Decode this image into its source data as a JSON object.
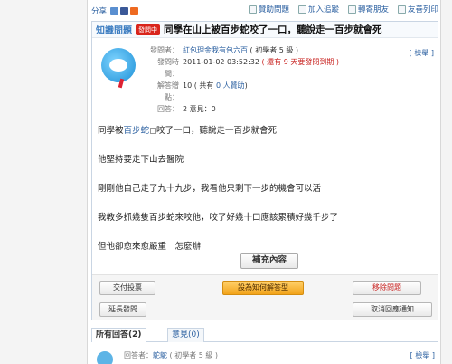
{
  "share_bar": {
    "share_label": "分享",
    "actions": {
      "like": "贊助問題",
      "track": "加入追蹤",
      "forward": "轉寄朋友",
      "print": "友善列印"
    }
  },
  "question": {
    "category": "知識問題",
    "badge": "發問中",
    "title": "同學在山上被百步蛇咬了一口，聽說走一百步就會死",
    "report_label": "[ 檢舉 ]",
    "meta": {
      "asker_label": "發問者：",
      "asker_name": "紅包理金我有包六百",
      "asker_level": "( 初學者 5 級 )",
      "time_label": "發問時間：",
      "time_value": "2011-01-02 03:52:32",
      "time_note": "( 還有 9 天要發問到期 )",
      "points_label": "解答贈點：",
      "points_value": "10",
      "points_note_prefix": "( 共有",
      "points_note_count": "0 人贊助",
      "points_note_suffix": ")",
      "replies_label": "回答：",
      "replies_value": "2 意見：0"
    },
    "body": {
      "line1_prefix": "同學被",
      "line1_kw": "百步蛇",
      "line1_suffix": "咬了一口，聽說走一百步就會死",
      "line2": "他堅持要走下山去醫院",
      "line3": "剛剛他自己走了九十九步，我看他只剩下一步的機會可以活",
      "line4": "我教多抓幾隻百步蛇來咬他，咬了好幾十口應該累積好幾千步了",
      "line5": "但他卻愈來愈嚴重　怎麼辦"
    },
    "supplement_label": "補充內容"
  },
  "actions": {
    "vote": "交付投票",
    "best": "設為知何解答型",
    "move": "移除問題",
    "report": "[ 檢舉 ]",
    "extend": "延長發問",
    "cancel_notify": "取消回應通知"
  },
  "tabs": {
    "all_answers": "所有回答(2)",
    "opinions": "意見(0)"
  },
  "answer": {
    "meta_label": "回答者：",
    "meta_name": "鴕鴕",
    "meta_level": "( 初學者 5 級 )",
    "report_label": "[ 檢舉 ]"
  },
  "colors": {
    "link": "#2a5fa0",
    "accent_red": "#c8201e",
    "best_button": "#f2a31a"
  }
}
